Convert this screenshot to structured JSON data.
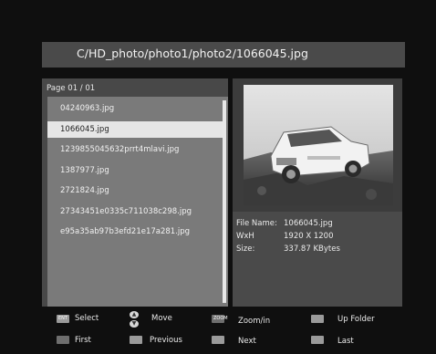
{
  "path_title": "C/HD_photo/photo1/photo2/1066045.jpg",
  "page_label": "Page  01 / 01",
  "files": [
    "04240963.jpg",
    "1066045.jpg",
    "1239855045632prrt4mlavi.jpg",
    "1387977.jpg",
    "2721824.jpg",
    "27343451e0335c711038c298.jpg",
    "e95a35ab97b3efd21e17a281.jpg"
  ],
  "selected_file_index": 1,
  "info": {
    "name_key": "File Name:",
    "name_val": "1066045.jpg",
    "size_key": "WxH",
    "size_val": "1920 X 1200",
    "bytes_key": "Size:",
    "bytes_val": "337.87 KBytes"
  },
  "legend": {
    "select": "Select",
    "move": "Move",
    "zoom": "Zoom/in",
    "up_folder": "Up Folder",
    "first": "First",
    "previous": "Previous",
    "next": "Next",
    "last": "Last",
    "zoom_chip": "ZOOM"
  },
  "icons": {
    "select_key": "enter-key-icon",
    "move_key": "up-down-arrow-icon",
    "zoom_key": "zoom-key-icon",
    "up_folder_key": "up-folder-key-icon",
    "first_key": "first-key-icon",
    "previous_key": "previous-key-icon",
    "next_key": "next-key-icon",
    "last_key": "last-key-icon"
  }
}
